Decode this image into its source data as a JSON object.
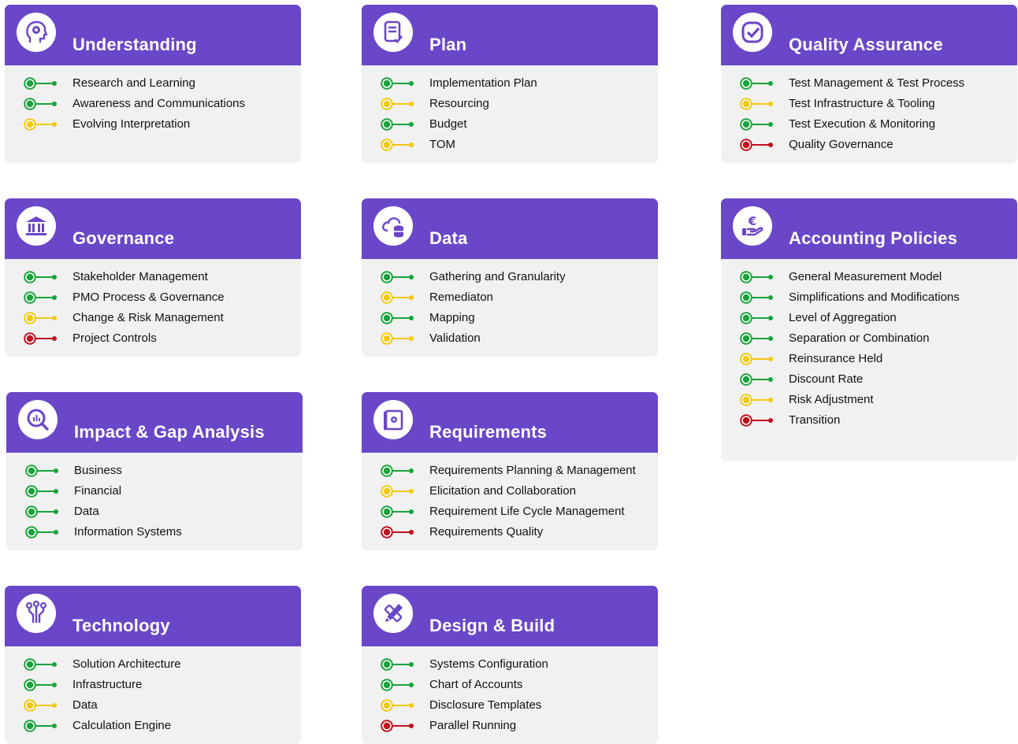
{
  "colors": {
    "header": "#6a46c8",
    "card": "#f1f1f1",
    "green": "#19a33a",
    "yellow": "#f2c811",
    "red": "#c0101e"
  },
  "cards": [
    {
      "id": "understanding",
      "title": "Understanding",
      "icon": "head-gear-icon",
      "items": [
        {
          "label": "Research and Learning",
          "status": "green"
        },
        {
          "label": "Awareness and Communications",
          "status": "green"
        },
        {
          "label": "Evolving Interpretation",
          "status": "yellow"
        }
      ]
    },
    {
      "id": "plan",
      "title": "Plan",
      "icon": "document-check-icon",
      "items": [
        {
          "label": "Implementation Plan",
          "status": "green"
        },
        {
          "label": "Resourcing",
          "status": "yellow"
        },
        {
          "label": "Budget",
          "status": "green"
        },
        {
          "label": "TOM",
          "status": "yellow"
        }
      ]
    },
    {
      "id": "quality-assurance",
      "title": "Quality Assurance",
      "icon": "check-badge-icon",
      "items": [
        {
          "label": "Test Management & Test Process",
          "status": "green"
        },
        {
          "label": "Test Infrastructure & Tooling",
          "status": "yellow"
        },
        {
          "label": "Test Execution & Monitoring",
          "status": "green"
        },
        {
          "label": "Quality Governance",
          "status": "red"
        }
      ]
    },
    {
      "id": "governance",
      "title": "Governance",
      "icon": "bank-icon",
      "items": [
        {
          "label": "Stakeholder Management",
          "status": "green"
        },
        {
          "label": "PMO Process & Governance",
          "status": "green"
        },
        {
          "label": "Change & Risk Management",
          "status": "yellow"
        },
        {
          "label": "Project Controls",
          "status": "red"
        }
      ]
    },
    {
      "id": "data",
      "title": "Data",
      "icon": "cloud-database-icon",
      "items": [
        {
          "label": "Gathering and Granularity",
          "status": "green"
        },
        {
          "label": "Remediaton",
          "status": "yellow"
        },
        {
          "label": "Mapping",
          "status": "green"
        },
        {
          "label": "Validation",
          "status": "yellow"
        }
      ]
    },
    {
      "id": "accounting-policies",
      "title": "Accounting Policies",
      "icon": "euro-hand-icon",
      "items": [
        {
          "label": "General Measurement Model",
          "status": "green"
        },
        {
          "label": "Simplifications and Modifications",
          "status": "green"
        },
        {
          "label": "Level of Aggregation",
          "status": "green"
        },
        {
          "label": "Separation or Combination",
          "status": "green"
        },
        {
          "label": "Reinsurance Held",
          "status": "yellow"
        },
        {
          "label": "Discount Rate",
          "status": "green"
        },
        {
          "label": "Risk Adjustment",
          "status": "yellow"
        },
        {
          "label": "Transition",
          "status": "red"
        }
      ]
    },
    {
      "id": "impact-gap",
      "title": "Impact & Gap Analysis",
      "icon": "magnifier-chart-icon",
      "items": [
        {
          "label": "Business",
          "status": "green"
        },
        {
          "label": "Financial",
          "status": "green"
        },
        {
          "label": "Data",
          "status": "green"
        },
        {
          "label": "Information Systems",
          "status": "green"
        }
      ]
    },
    {
      "id": "requirements",
      "title": "Requirements",
      "icon": "blueprint-gear-icon",
      "items": [
        {
          "label": "Requirements Planning & Management",
          "status": "green"
        },
        {
          "label": "Elicitation and Collaboration",
          "status": "yellow"
        },
        {
          "label": "Requirement Life Cycle Management",
          "status": "green"
        },
        {
          "label": "Requirements Quality",
          "status": "red"
        }
      ]
    },
    {
      "id": "technology",
      "title": "Technology",
      "icon": "circuit-icon",
      "items": [
        {
          "label": "Solution Architecture",
          "status": "green"
        },
        {
          "label": "Infrastructure",
          "status": "green"
        },
        {
          "label": "Data",
          "status": "yellow"
        },
        {
          "label": "Calculation Engine",
          "status": "green"
        }
      ]
    },
    {
      "id": "design-build",
      "title": "Design & Build",
      "icon": "pencil-ruler-icon",
      "items": [
        {
          "label": "Systems Configuration",
          "status": "green"
        },
        {
          "label": "Chart of Accounts",
          "status": "green"
        },
        {
          "label": "Disclosure Templates",
          "status": "yellow"
        },
        {
          "label": "Parallel Running",
          "status": "red"
        }
      ]
    }
  ]
}
